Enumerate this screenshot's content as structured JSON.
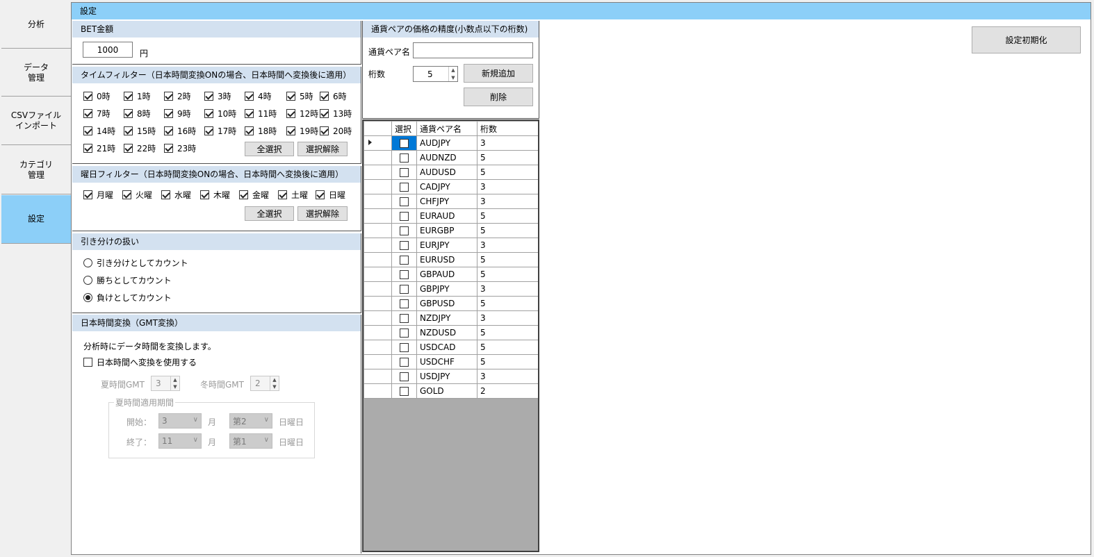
{
  "nav": {
    "tabs": [
      {
        "label": "分析"
      },
      {
        "label": "データ\n管理"
      },
      {
        "label": "CSVファイル\nインポート"
      },
      {
        "label": "カテゴリ\n管理"
      },
      {
        "label": "設定"
      }
    ]
  },
  "header": {
    "title": "設定"
  },
  "bet": {
    "title": "BET金額",
    "value": "1000",
    "unit": "円"
  },
  "time_filter": {
    "title": "タイムフィルター（日本時間変換ONの場合、日本時間へ変換後に適用）",
    "hours": [
      "0時",
      "1時",
      "2時",
      "3時",
      "4時",
      "5時",
      "6時",
      "7時",
      "8時",
      "9時",
      "10時",
      "11時",
      "12時",
      "13時",
      "14時",
      "15時",
      "16時",
      "17時",
      "18時",
      "19時",
      "20時",
      "21時",
      "22時",
      "23時"
    ],
    "select_all": "全選択",
    "deselect": "選択解除"
  },
  "day_filter": {
    "title": "曜日フィルター（日本時間変換ONの場合、日本時間へ変換後に適用）",
    "days": [
      "月曜",
      "火曜",
      "水曜",
      "木曜",
      "金曜",
      "土曜",
      "日曜"
    ],
    "select_all": "全選択",
    "deselect": "選択解除"
  },
  "draw": {
    "title": "引き分けの扱い",
    "options": [
      "引き分けとしてカウント",
      "勝ちとしてカウント",
      "負けとしてカウント"
    ],
    "selected": 2
  },
  "gmt": {
    "title": "日本時間変換（GMT変換）",
    "desc": "分析時にデータ時間を変換します。",
    "use_label": "日本時間へ変換を使用する",
    "summer_label": "夏時間GMT",
    "summer_value": "3",
    "winter_label": "冬時間GMT",
    "winter_value": "2",
    "period_title": "夏時間適用期間",
    "start_label": "開始：",
    "start_month": "3",
    "start_week": "第2",
    "end_label": "終了：",
    "end_month": "11",
    "end_week": "第1",
    "month_unit": "月",
    "sunday": "日曜日"
  },
  "precision": {
    "title": "通貨ペアの価格の精度(小数点以下の桁数)",
    "pair_label": "通貨ペア名",
    "pair_value": "",
    "digits_label": "桁数",
    "digits_value": "5",
    "add_button": "新規追加",
    "delete_button": "削除",
    "columns": [
      "選択",
      "通貨ペア名",
      "桁数"
    ],
    "rows": [
      {
        "pair": "AUDJPY",
        "digits": "3"
      },
      {
        "pair": "AUDNZD",
        "digits": "5"
      },
      {
        "pair": "AUDUSD",
        "digits": "5"
      },
      {
        "pair": "CADJPY",
        "digits": "3"
      },
      {
        "pair": "CHFJPY",
        "digits": "3"
      },
      {
        "pair": "EURAUD",
        "digits": "5"
      },
      {
        "pair": "EURGBP",
        "digits": "5"
      },
      {
        "pair": "EURJPY",
        "digits": "3"
      },
      {
        "pair": "EURUSD",
        "digits": "5"
      },
      {
        "pair": "GBPAUD",
        "digits": "5"
      },
      {
        "pair": "GBPJPY",
        "digits": "3"
      },
      {
        "pair": "GBPUSD",
        "digits": "5"
      },
      {
        "pair": "NZDJPY",
        "digits": "3"
      },
      {
        "pair": "NZDUSD",
        "digits": "5"
      },
      {
        "pair": "USDCAD",
        "digits": "5"
      },
      {
        "pair": "USDCHF",
        "digits": "5"
      },
      {
        "pair": "USDJPY",
        "digits": "3"
      },
      {
        "pair": "GOLD",
        "digits": "2"
      }
    ]
  },
  "reset_button": "設定初期化",
  "colors": {
    "accent": "#8ccff8",
    "header_band": "#d3e1f0",
    "selected_cell": "#0078d7",
    "grid_empty": "#ababab"
  }
}
